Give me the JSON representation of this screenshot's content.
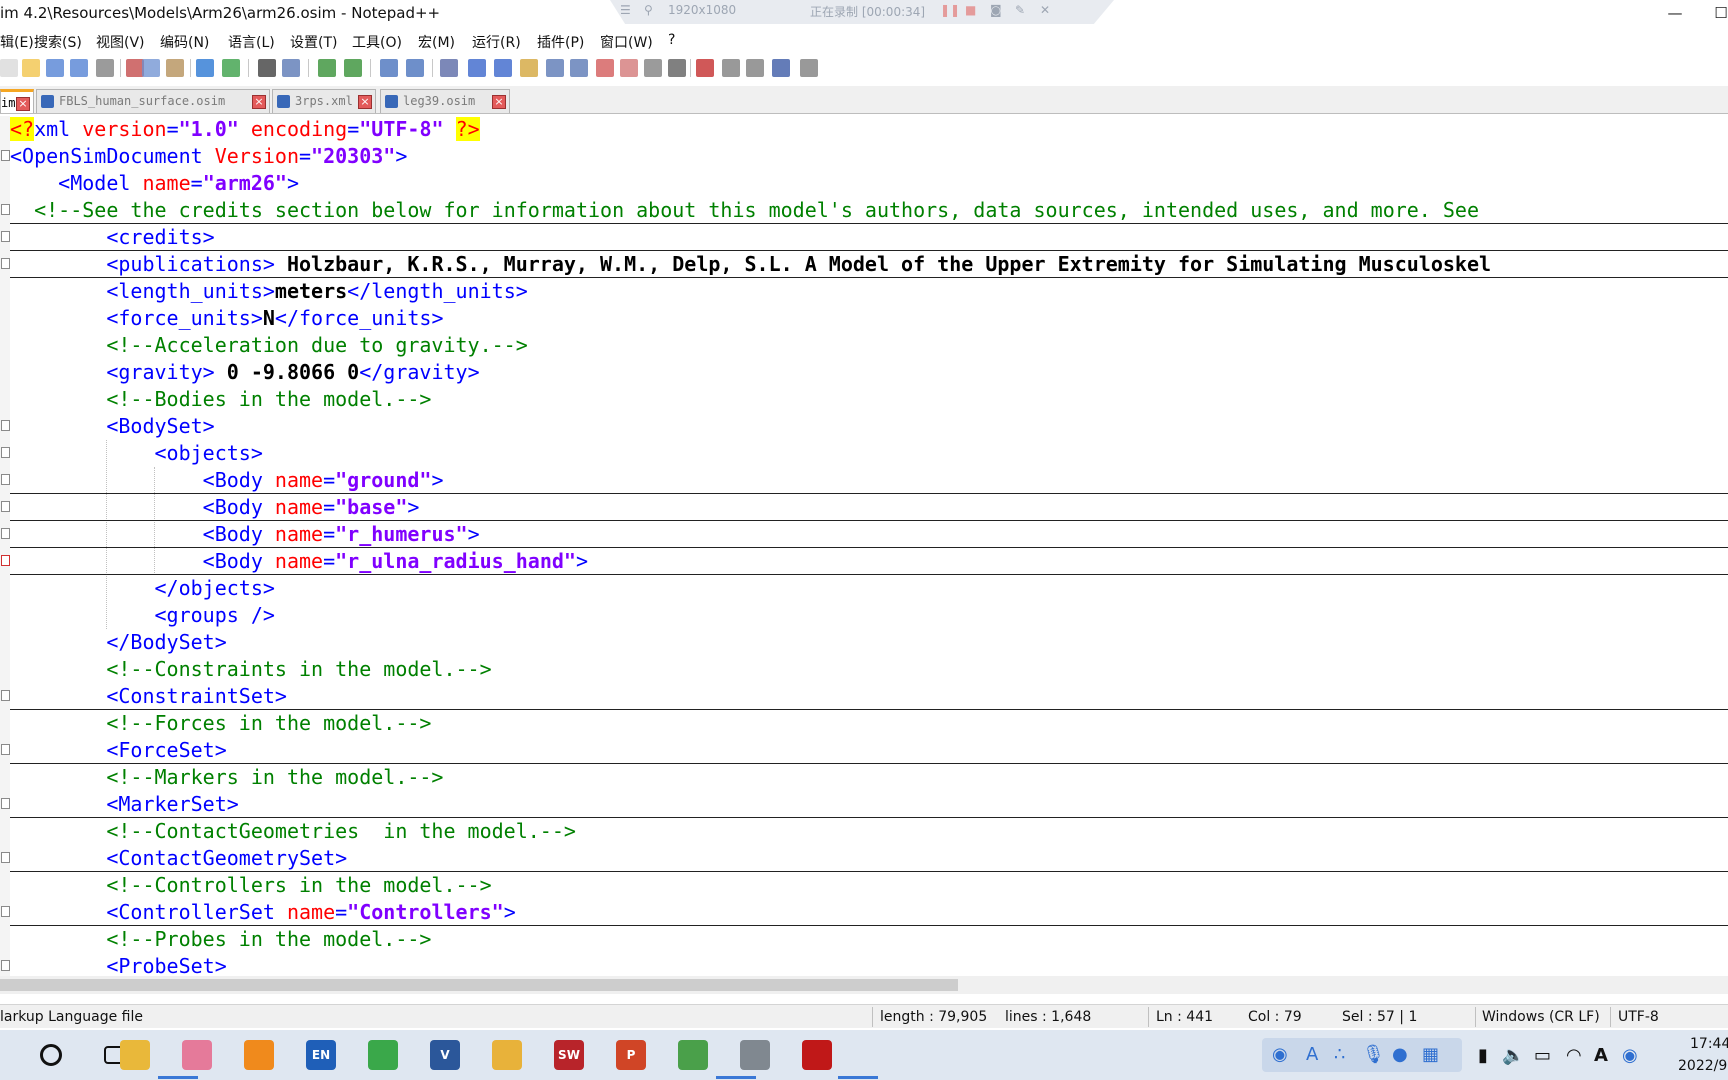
{
  "window": {
    "title": "im 4.2\\Resources\\Models\\Arm26\\arm26.osim - Notepad++",
    "minimize_glyph": "—",
    "maximize_glyph": "☐"
  },
  "recorder": {
    "resolution": "1920x1080",
    "status": "正在录制 [00:00:34]"
  },
  "menu": [
    "辑(E)",
    "搜索(S)",
    "视图(V)",
    "编码(N)",
    "语言(L)",
    "设置(T)",
    "工具(O)",
    "宏(M)",
    "运行(R)",
    "插件(P)",
    "窗口(W)",
    "?"
  ],
  "tabs": [
    {
      "label": "im",
      "active": true
    },
    {
      "label": "FBLS_human_surface.osim",
      "active": false
    },
    {
      "label": "3rps.xml",
      "active": false
    },
    {
      "label": "leg39.osim",
      "active": false
    }
  ],
  "tab_close_glyph": "×",
  "editor": {
    "lines": [
      {
        "indent": 0,
        "fold": "",
        "underline": false,
        "tokens": [
          [
            "pi",
            "<?"
          ],
          [
            "tag",
            "xml "
          ],
          [
            "attr",
            "version"
          ],
          [
            "tag",
            "="
          ],
          [
            "val",
            "\"1.0\""
          ],
          [
            "tag",
            " "
          ],
          [
            "attr",
            "encoding"
          ],
          [
            "tag",
            "="
          ],
          [
            "val",
            "\"UTF-8\""
          ],
          [
            "tag",
            " "
          ],
          [
            "pi",
            "?>"
          ]
        ]
      },
      {
        "indent": 0,
        "fold": "box",
        "underline": false,
        "tokens": [
          [
            "tag",
            "<OpenSimDocument "
          ],
          [
            "attr",
            "Version"
          ],
          [
            "tag",
            "="
          ],
          [
            "val",
            "\"20303\""
          ],
          [
            "tag",
            ">"
          ]
        ]
      },
      {
        "indent": 4,
        "fold": "",
        "underline": false,
        "tokens": [
          [
            "tag",
            "<Model "
          ],
          [
            "attr",
            "name"
          ],
          [
            "tag",
            "="
          ],
          [
            "val",
            "\"arm26\""
          ],
          [
            "tag",
            ">"
          ]
        ]
      },
      {
        "indent": 2,
        "fold": "box",
        "underline": true,
        "tokens": [
          [
            "cmt",
            "<!--See the credits section below for information about this model's authors, data sources, intended uses, and more. See"
          ]
        ]
      },
      {
        "indent": 8,
        "fold": "box",
        "underline": true,
        "tokens": [
          [
            "tag",
            "<credits>"
          ]
        ]
      },
      {
        "indent": 8,
        "fold": "box",
        "underline": true,
        "tokens": [
          [
            "tag",
            "<publications>"
          ],
          [
            "txt",
            " Holzbaur, K.R.S., Murray, W.M., Delp, S.L. A Model of the Upper Extremity for Simulating Musculoskel"
          ]
        ]
      },
      {
        "indent": 8,
        "fold": "",
        "underline": false,
        "tokens": [
          [
            "tag",
            "<length_units>"
          ],
          [
            "txt",
            "meters"
          ],
          [
            "tag",
            "</length_units>"
          ]
        ]
      },
      {
        "indent": 8,
        "fold": "",
        "underline": false,
        "tokens": [
          [
            "tag",
            "<force_units>"
          ],
          [
            "txt",
            "N"
          ],
          [
            "tag",
            "</force_units>"
          ]
        ]
      },
      {
        "indent": 8,
        "fold": "",
        "underline": false,
        "tokens": [
          [
            "cmt",
            "<!--Acceleration due to gravity.-->"
          ]
        ]
      },
      {
        "indent": 8,
        "fold": "",
        "underline": false,
        "tokens": [
          [
            "tag",
            "<gravity>"
          ],
          [
            "txt",
            " 0 -9.8066 0"
          ],
          [
            "tag",
            "</gravity>"
          ]
        ]
      },
      {
        "indent": 8,
        "fold": "",
        "underline": false,
        "tokens": [
          [
            "cmt",
            "<!--Bodies in the model.-->"
          ]
        ]
      },
      {
        "indent": 8,
        "fold": "box",
        "underline": false,
        "tokens": [
          [
            "tag",
            "<BodySet>"
          ]
        ]
      },
      {
        "indent": 12,
        "fold": "box",
        "underline": false,
        "tokens": [
          [
            "tag",
            "<objects>"
          ]
        ]
      },
      {
        "indent": 16,
        "fold": "box",
        "underline": true,
        "tokens": [
          [
            "tag",
            "<Body "
          ],
          [
            "attr",
            "name"
          ],
          [
            "tag",
            "="
          ],
          [
            "val",
            "\"ground\""
          ],
          [
            "tag",
            ">"
          ]
        ]
      },
      {
        "indent": 16,
        "fold": "box",
        "underline": true,
        "tokens": [
          [
            "tag",
            "<Body "
          ],
          [
            "attr",
            "name"
          ],
          [
            "tag",
            "="
          ],
          [
            "val",
            "\"base\""
          ],
          [
            "tag",
            ">"
          ]
        ]
      },
      {
        "indent": 16,
        "fold": "box",
        "underline": true,
        "tokens": [
          [
            "tag",
            "<Body "
          ],
          [
            "attr",
            "name"
          ],
          [
            "tag",
            "="
          ],
          [
            "val",
            "\"r_humerus\""
          ],
          [
            "tag",
            ">"
          ]
        ]
      },
      {
        "indent": 16,
        "fold": "red",
        "underline": true,
        "tokens": [
          [
            "tag",
            "<Body "
          ],
          [
            "attr",
            "name"
          ],
          [
            "tag",
            "="
          ],
          [
            "val",
            "\"r_ulna_radius_hand\""
          ],
          [
            "tag",
            ">"
          ]
        ]
      },
      {
        "indent": 12,
        "fold": "",
        "underline": false,
        "tokens": [
          [
            "tag",
            "</objects>"
          ]
        ]
      },
      {
        "indent": 12,
        "fold": "",
        "underline": false,
        "tokens": [
          [
            "tag",
            "<groups />"
          ]
        ]
      },
      {
        "indent": 8,
        "fold": "",
        "underline": false,
        "tokens": [
          [
            "tag",
            "</BodySet>"
          ]
        ]
      },
      {
        "indent": 8,
        "fold": "",
        "underline": false,
        "tokens": [
          [
            "cmt",
            "<!--Constraints in the model.-->"
          ]
        ]
      },
      {
        "indent": 8,
        "fold": "box",
        "underline": true,
        "tokens": [
          [
            "tag",
            "<ConstraintSet>"
          ]
        ]
      },
      {
        "indent": 8,
        "fold": "",
        "underline": false,
        "tokens": [
          [
            "cmt",
            "<!--Forces in the model.-->"
          ]
        ]
      },
      {
        "indent": 8,
        "fold": "box",
        "underline": true,
        "tokens": [
          [
            "tag",
            "<ForceSet>"
          ]
        ]
      },
      {
        "indent": 8,
        "fold": "",
        "underline": false,
        "tokens": [
          [
            "cmt",
            "<!--Markers in the model.-->"
          ]
        ]
      },
      {
        "indent": 8,
        "fold": "box",
        "underline": true,
        "tokens": [
          [
            "tag",
            "<MarkerSet>"
          ]
        ]
      },
      {
        "indent": 8,
        "fold": "",
        "underline": false,
        "tokens": [
          [
            "cmt",
            "<!--ContactGeometries  in the model.-->"
          ]
        ]
      },
      {
        "indent": 8,
        "fold": "box",
        "underline": true,
        "tokens": [
          [
            "tag",
            "<ContactGeometrySet>"
          ]
        ]
      },
      {
        "indent": 8,
        "fold": "",
        "underline": false,
        "tokens": [
          [
            "cmt",
            "<!--Controllers in the model.-->"
          ]
        ]
      },
      {
        "indent": 8,
        "fold": "box",
        "underline": true,
        "tokens": [
          [
            "tag",
            "<ControllerSet "
          ],
          [
            "attr",
            "name"
          ],
          [
            "tag",
            "="
          ],
          [
            "val",
            "\"Controllers\""
          ],
          [
            "tag",
            ">"
          ]
        ]
      },
      {
        "indent": 8,
        "fold": "",
        "underline": false,
        "tokens": [
          [
            "cmt",
            "<!--Probes in the model.-->"
          ]
        ]
      },
      {
        "indent": 8,
        "fold": "box",
        "underline": false,
        "tokens": [
          [
            "tag",
            "<ProbeSet>"
          ]
        ]
      }
    ]
  },
  "status": {
    "file_type": "larkup Language file",
    "length": "length : 79,905",
    "lines": "lines : 1,648",
    "ln": "Ln : 441",
    "col": "Col : 79",
    "sel": "Sel : 57 | 1",
    "eol": "Windows (CR LF)",
    "encoding": "UTF-8"
  },
  "taskbar": {
    "apps": [
      "search-app",
      "task-view",
      "file-explorer",
      "app-flower",
      "search-magnifier",
      "language-en",
      "refresh-app",
      "visio",
      "chrome",
      "solidworks",
      "powerpoint",
      "notepad-plus-plus",
      "opensim",
      "recorder"
    ],
    "time": "17:44",
    "date": "2022/9"
  },
  "colors": {
    "tag": "#0000ff",
    "attr": "#ff0000",
    "value": "#8000ff",
    "comment": "#008000",
    "pi_background": "#ffff00"
  }
}
